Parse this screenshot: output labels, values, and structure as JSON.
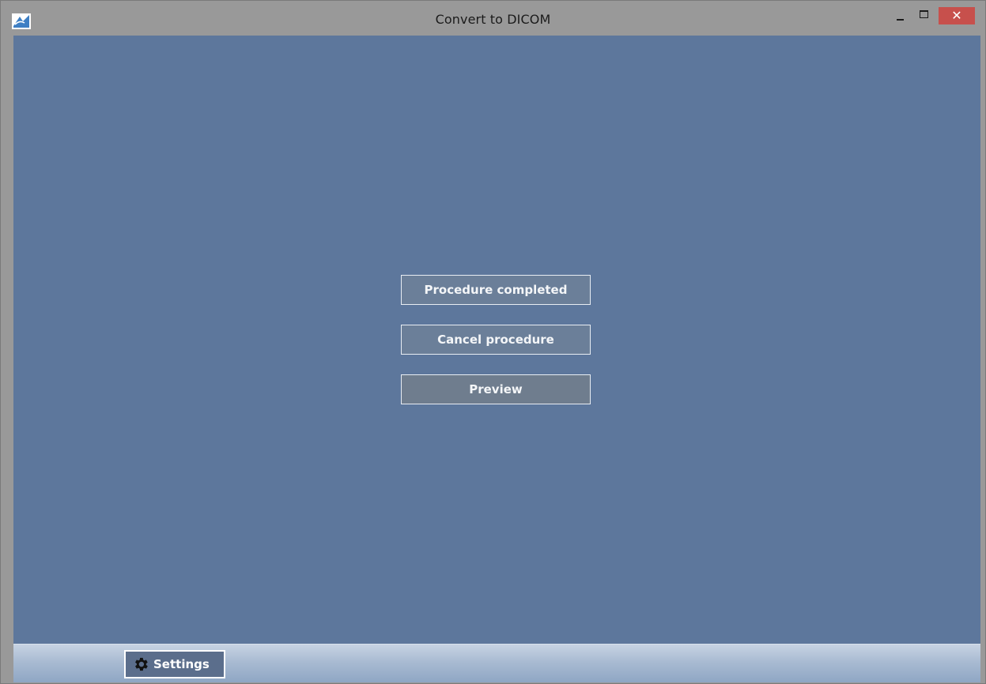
{
  "window": {
    "title": "Convert to DICOM",
    "controls": {
      "minimize_icon": "minimize-icon",
      "maximize_icon": "maximize-icon",
      "close_glyph": "✕"
    }
  },
  "main": {
    "buttons": [
      {
        "label": "Procedure completed"
      },
      {
        "label": "Cancel procedure"
      },
      {
        "label": "Preview"
      }
    ]
  },
  "bottombar": {
    "settings_label": "Settings",
    "settings_icon": "gear-icon"
  },
  "colors": {
    "titlebar": "#999999",
    "content_background": "#5d779c",
    "close_button": "#c7504c"
  }
}
